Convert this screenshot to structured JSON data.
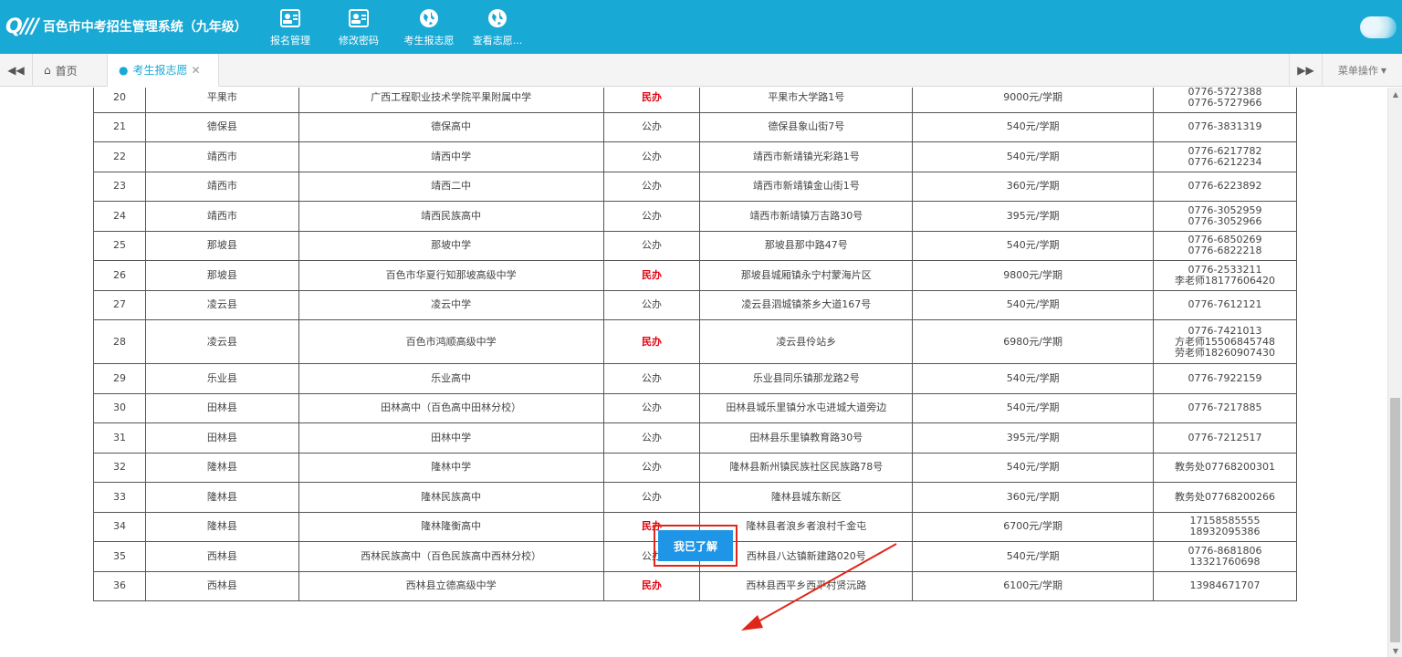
{
  "header": {
    "logo_mark": "Q///",
    "title": "百色市中考招生管理系统（九年级）",
    "nav": [
      {
        "label": "报名管理",
        "icon": "id-card-icon"
      },
      {
        "label": "修改密码",
        "icon": "id-card-icon"
      },
      {
        "label": "考生报志愿",
        "icon": "globe-icon"
      },
      {
        "label": "查看志愿...",
        "icon": "globe-icon"
      }
    ]
  },
  "tabs": {
    "home": "首页",
    "active": "考生报志愿",
    "menu_ops": "菜单操作"
  },
  "schools": [
    {
      "no": "20",
      "city": "平果市",
      "name": "广西工程职业技术学院平果附属中学",
      "type": "民办",
      "private": true,
      "address": "平果市大学路1号",
      "fee": "9000元/学期",
      "tel": [
        "0776-5727388",
        "0776-5727966"
      ]
    },
    {
      "no": "21",
      "city": "德保县",
      "name": "德保高中",
      "type": "公办",
      "private": false,
      "address": "德保县象山街7号",
      "fee": "540元/学期",
      "tel": [
        "0776-3831319"
      ]
    },
    {
      "no": "22",
      "city": "靖西市",
      "name": "靖西中学",
      "type": "公办",
      "private": false,
      "address": "靖西市新靖镇光彩路1号",
      "fee": "540元/学期",
      "tel": [
        "0776-6217782",
        "0776-6212234"
      ]
    },
    {
      "no": "23",
      "city": "靖西市",
      "name": "靖西二中",
      "type": "公办",
      "private": false,
      "address": "靖西市新靖镇金山街1号",
      "fee": "360元/学期",
      "tel": [
        "0776-6223892"
      ]
    },
    {
      "no": "24",
      "city": "靖西市",
      "name": "靖西民族高中",
      "type": "公办",
      "private": false,
      "address": "靖西市新靖镇万吉路30号",
      "fee": "395元/学期",
      "tel": [
        "0776-3052959",
        "0776-3052966"
      ]
    },
    {
      "no": "25",
      "city": "那坡县",
      "name": "那坡中学",
      "type": "公办",
      "private": false,
      "address": "那坡县那中路47号",
      "fee": "540元/学期",
      "tel": [
        "0776-6850269",
        "0776-6822218"
      ]
    },
    {
      "no": "26",
      "city": "那坡县",
      "name": "百色市华夏行知那坡高级中学",
      "type": "民办",
      "private": true,
      "address": "那坡县城厢镇永宁村蒙海片区",
      "fee": "9800元/学期",
      "tel": [
        "0776-2533211",
        "李老师18177606420"
      ]
    },
    {
      "no": "27",
      "city": "凌云县",
      "name": "凌云中学",
      "type": "公办",
      "private": false,
      "address": "凌云县泗城镇茶乡大道167号",
      "fee": "540元/学期",
      "tel": [
        "0776-7612121"
      ]
    },
    {
      "no": "28",
      "city": "凌云县",
      "name": "百色市鸿顺高级中学",
      "type": "民办",
      "private": true,
      "address": "凌云县伶站乡",
      "fee": "6980元/学期",
      "tel": [
        "0776-7421013",
        "方老师15506845748",
        "劳老师18260907430"
      ]
    },
    {
      "no": "29",
      "city": "乐业县",
      "name": "乐业高中",
      "type": "公办",
      "private": false,
      "address": "乐业县同乐镇那龙路2号",
      "fee": "540元/学期",
      "tel": [
        "0776-7922159"
      ]
    },
    {
      "no": "30",
      "city": "田林县",
      "name": "田林高中（百色高中田林分校）",
      "type": "公办",
      "private": false,
      "address": "田林县城乐里镇分水屯进城大道旁边",
      "fee": "540元/学期",
      "tel": [
        "0776-7217885"
      ]
    },
    {
      "no": "31",
      "city": "田林县",
      "name": "田林中学",
      "type": "公办",
      "private": false,
      "address": "田林县乐里镇教育路30号",
      "fee": "395元/学期",
      "tel": [
        "0776-7212517"
      ]
    },
    {
      "no": "32",
      "city": "隆林县",
      "name": "隆林中学",
      "type": "公办",
      "private": false,
      "address": "隆林县新州镇民族社区民族路78号",
      "fee": "540元/学期",
      "tel": [
        "教务处07768200301"
      ]
    },
    {
      "no": "33",
      "city": "隆林县",
      "name": "隆林民族高中",
      "type": "公办",
      "private": false,
      "address": "隆林县城东新区",
      "fee": "360元/学期",
      "tel": [
        "教务处07768200266"
      ]
    },
    {
      "no": "34",
      "city": "隆林县",
      "name": "隆林隆衡高中",
      "type": "民办",
      "private": true,
      "address": "隆林县者浪乡者浪村千金屯",
      "fee": "6700元/学期",
      "tel": [
        "17158585555",
        "18932095386"
      ]
    },
    {
      "no": "35",
      "city": "西林县",
      "name": "西林民族高中（百色民族高中西林分校）",
      "type": "公办",
      "private": false,
      "address": "西林县八达镇新建路020号",
      "fee": "540元/学期",
      "tel": [
        "0776-8681806",
        "13321760698"
      ]
    },
    {
      "no": "36",
      "city": "西林县",
      "name": "西林县立德高级中学",
      "type": "民办",
      "private": true,
      "address": "西林县西平乡西平村贤沅路",
      "fee": "6100元/学期",
      "tel": [
        "13984671707"
      ]
    }
  ],
  "ack_button": "我已了解",
  "colors": {
    "header": "#19a9d5",
    "private_text": "#e0000f",
    "button": "#1e95e6",
    "highlight": "#e0261a"
  }
}
